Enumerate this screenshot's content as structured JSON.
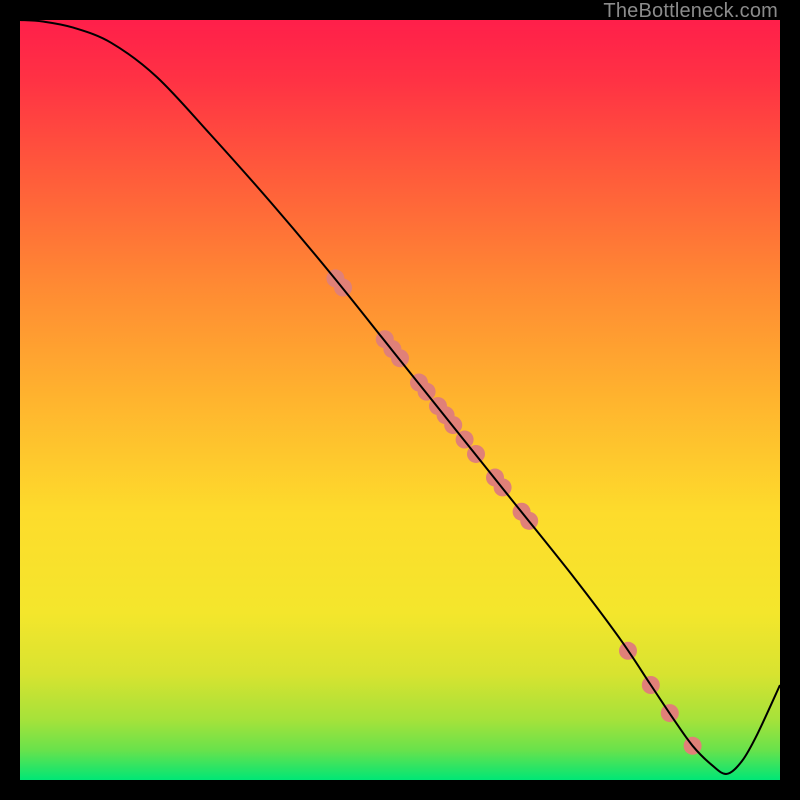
{
  "watermark": "TheBottleneck.com",
  "chart_data": {
    "type": "line",
    "title": "",
    "xlabel": "",
    "ylabel": "",
    "xlim": [
      0,
      100
    ],
    "ylim": [
      0,
      100
    ],
    "background_gradient": {
      "stops": [
        {
          "pos": 0.0,
          "color": "#00e676"
        },
        {
          "pos": 0.04,
          "color": "#6ae24b"
        },
        {
          "pos": 0.08,
          "color": "#a6e23a"
        },
        {
          "pos": 0.14,
          "color": "#d8e330"
        },
        {
          "pos": 0.22,
          "color": "#f4e62c"
        },
        {
          "pos": 0.35,
          "color": "#fddc2c"
        },
        {
          "pos": 0.5,
          "color": "#ffb42e"
        },
        {
          "pos": 0.65,
          "color": "#ff8a33"
        },
        {
          "pos": 0.8,
          "color": "#ff5a3b"
        },
        {
          "pos": 0.92,
          "color": "#ff3244"
        },
        {
          "pos": 1.0,
          "color": "#ff1f4a"
        }
      ]
    },
    "series": [
      {
        "name": "curve",
        "color": "#000000",
        "width": 2.0,
        "x": [
          0,
          3,
          7,
          12,
          18,
          25,
          33,
          41,
          49,
          57,
          65,
          73,
          79,
          83,
          86,
          88.5,
          91,
          93,
          95,
          97,
          100
        ],
        "y": [
          100,
          99.8,
          99.0,
          97.0,
          92.5,
          85.0,
          76.0,
          66.5,
          56.5,
          46.5,
          36.5,
          26.5,
          18.5,
          12.5,
          8.0,
          4.5,
          2.0,
          0.8,
          2.5,
          6.0,
          12.5
        ]
      },
      {
        "name": "markers",
        "color": "#e08078",
        "radius": 9,
        "points": [
          {
            "x": 41.5,
            "y": 66.0
          },
          {
            "x": 42.5,
            "y": 64.8
          },
          {
            "x": 48.0,
            "y": 58.0
          },
          {
            "x": 49.0,
            "y": 56.7
          },
          {
            "x": 50.0,
            "y": 55.5
          },
          {
            "x": 52.5,
            "y": 52.3
          },
          {
            "x": 53.5,
            "y": 51.1
          },
          {
            "x": 55.0,
            "y": 49.2
          },
          {
            "x": 56.0,
            "y": 48.0
          },
          {
            "x": 57.0,
            "y": 46.7
          },
          {
            "x": 58.5,
            "y": 44.8
          },
          {
            "x": 60.0,
            "y": 42.9
          },
          {
            "x": 62.5,
            "y": 39.8
          },
          {
            "x": 63.5,
            "y": 38.5
          },
          {
            "x": 66.0,
            "y": 35.3
          },
          {
            "x": 67.0,
            "y": 34.1
          },
          {
            "x": 80.0,
            "y": 17.0
          },
          {
            "x": 83.0,
            "y": 12.5
          },
          {
            "x": 85.5,
            "y": 8.8
          },
          {
            "x": 88.5,
            "y": 4.5
          }
        ]
      }
    ]
  }
}
